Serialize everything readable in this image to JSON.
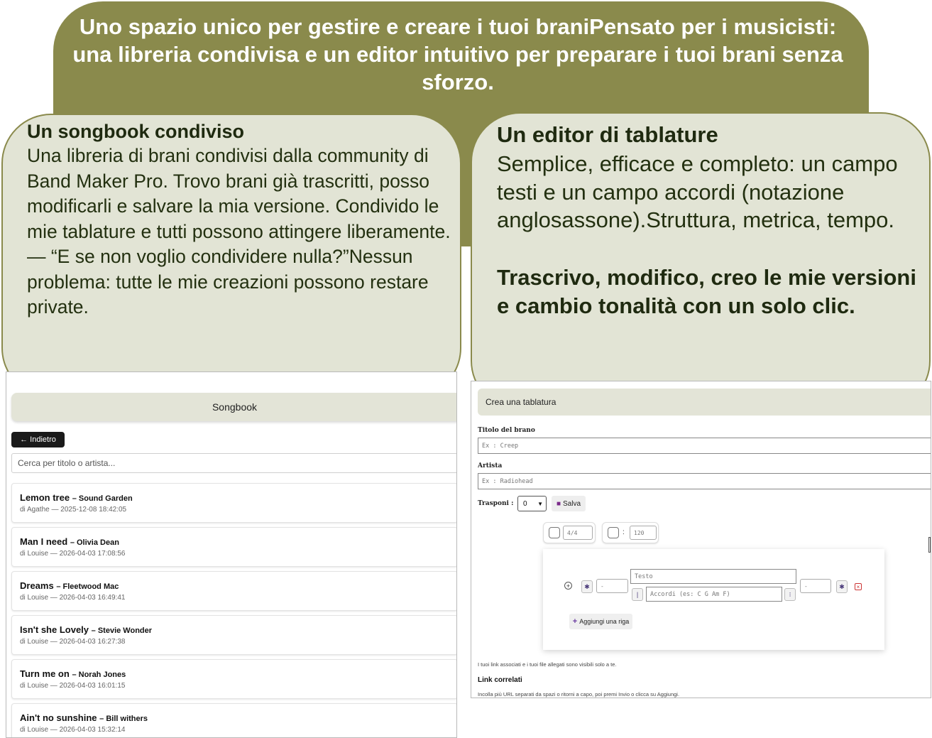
{
  "banner": {
    "text": "Uno spazio unico per gestire e creare i tuoi braniPensato per i musicisti: una libreria condivisa e un editor intuitivo per preparare i tuoi brani senza sforzo."
  },
  "left_card": {
    "title": "Un songbook condiviso",
    "body": "Una libreria di brani condivisi dalla community di Band Maker Pro. Trovo brani già trascritti, posso modificarli e salvare la mia versione. Condivido le mie tablature e tutti possono attingere liberamente.— “E se non voglio condividere nulla?”Nessun problema: tutte le mie creazioni possono restare private."
  },
  "right_card": {
    "title": "Un editor di tablature",
    "body": "Semplice, efficace e completo: un campo testi e un campo accordi (notazione anglosassone).Struttura, metrica, tempo.",
    "emphasis": "Trascrivo, modifico, creo le mie versioni e cambio tonalità con un solo clic."
  },
  "songbook": {
    "header": "Songbook",
    "back_label": "← Indietro",
    "search_placeholder": "Cerca per titolo o artista...",
    "songs": [
      {
        "title": "Lemon tree",
        "artist": "Sound Garden",
        "meta": "di Agathe — 2025-12-08 18:42:05"
      },
      {
        "title": "Man I need",
        "artist": "Olivia Dean",
        "meta": "di Louise — 2026-04-03 17:08:56"
      },
      {
        "title": "Dreams",
        "artist": "Fleetwood Mac",
        "meta": "di Louise — 2026-04-03 16:49:41"
      },
      {
        "title": "Isn't she Lovely",
        "artist": "Stevie Wonder",
        "meta": "di Louise — 2026-04-03 16:27:38"
      },
      {
        "title": "Turn me on",
        "artist": "Norah Jones",
        "meta": "di Louise — 2026-04-03 16:01:15"
      },
      {
        "title": "Ain't no sunshine",
        "artist": "Bill withers",
        "meta": "di Louise — 2026-04-03 15:32:14"
      }
    ]
  },
  "editor": {
    "header": "Crea una tablatura",
    "title_label": "Titolo del brano",
    "title_placeholder": "Ex : Creep",
    "artist_label": "Artista",
    "artist_placeholder": "Ex : Radiohead",
    "transpose_label": "Trasponi :",
    "transpose_value": "0",
    "save_label": "Salva",
    "meter_value": "4/4",
    "tempo_value": "120",
    "text_placeholder": "Testo",
    "chords_placeholder": "Accordi (es: C G Am F)",
    "left_field": "-",
    "right_field": "-",
    "add_row_label": "Aggiungi una riga",
    "privacy_note": "I tuoi link associati e i tuoi file allegati sono visibili solo a te.",
    "links_title": "Link correlati",
    "links_hint": "Incolla più URL separati da spazi o ritorni a capo, poi premi Invio o clicca su Aggiungi."
  }
}
